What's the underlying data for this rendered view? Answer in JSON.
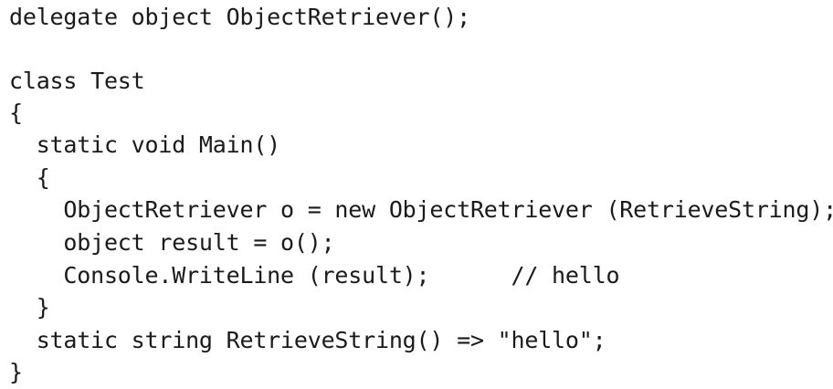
{
  "code": {
    "lines": [
      "delegate object ObjectRetriever();",
      "",
      "class Test",
      "{",
      "  static void Main()",
      "  {",
      "    ObjectRetriever o = new ObjectRetriever (RetrieveString);",
      "    object result = o();",
      "    Console.WriteLine (result);      // hello",
      "  }",
      "  static string RetrieveString() => \"hello\";",
      "}"
    ]
  }
}
